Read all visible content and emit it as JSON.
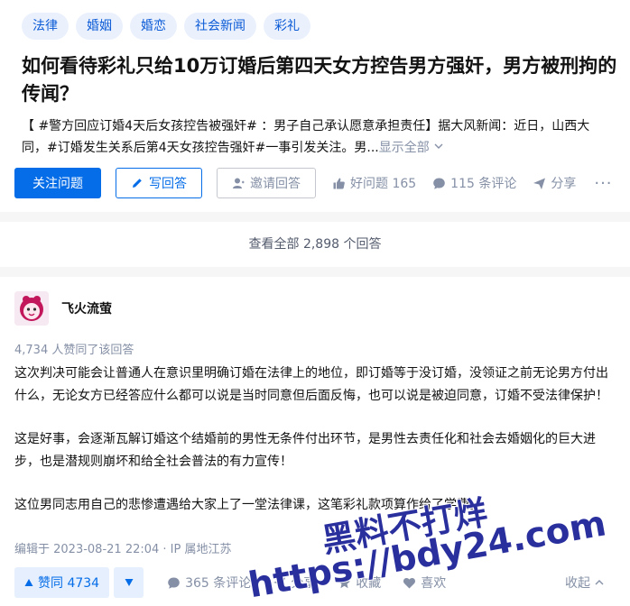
{
  "question": {
    "topics": [
      "法律",
      "婚姻",
      "婚恋",
      "社会新闻",
      "彩礼"
    ],
    "title": "如何看待彩礼只给10万订婚后第四天女方控告男方强奸，男方被刑拘的传闻？",
    "excerpt": "【 #警方回应订婚4天后女孩控告被强奸# ：男子自己承认愿意承担责任】据大风新闻：近日，山西大同，#订婚发生关系后第4天女孩控告强奸#一事引发关注。男...",
    "show_all": "显示全部",
    "follow_label": "关注问题",
    "write_answer_label": "写回答",
    "invite_label": "邀请回答",
    "good_question": "好问题 165",
    "comments": "115 条评论",
    "share": "分享",
    "more": "···"
  },
  "view_all": "查看全部 2,898 个回答",
  "answer": {
    "author_name": "飞火流萤",
    "votes_summary": "4,734 人赞同了该回答",
    "paragraphs": [
      "这次判决可能会让普通人在意识里明确订婚在法律上的地位，即订婚等于没订婚，没领证之前无论男方付出什么，无论女方已经答应什么都可以说是当时同意但后面反悔，也可以说是被迫同意，订婚不受法律保护！",
      "这是好事，会逐渐瓦解订婚这个结婚前的男性无条件付出环节，是男性去责任化和社会去婚姻化的巨大进步，也是潜规则崩坏和给全社会普法的有力宣传！",
      "这位男同志用自己的悲惨遭遇给大家上了一堂法律课，这笔彩礼款项算作给了学费。"
    ],
    "edited": "编辑于 2023-08-21 22:04 · IP 属地江苏",
    "upvote": "赞同 4734",
    "comments": "365 条评论",
    "share": "分享",
    "favorite": "收藏",
    "like": "喜欢",
    "collapse": "收起"
  },
  "watermark": {
    "line1": "黑料不打烊",
    "line2": "https://bdy24.com"
  },
  "colors": {
    "accent": "#056de8",
    "topic_bg": "#eaf1fd",
    "muted": "#8590a6",
    "watermark": "#2a2f9e"
  }
}
